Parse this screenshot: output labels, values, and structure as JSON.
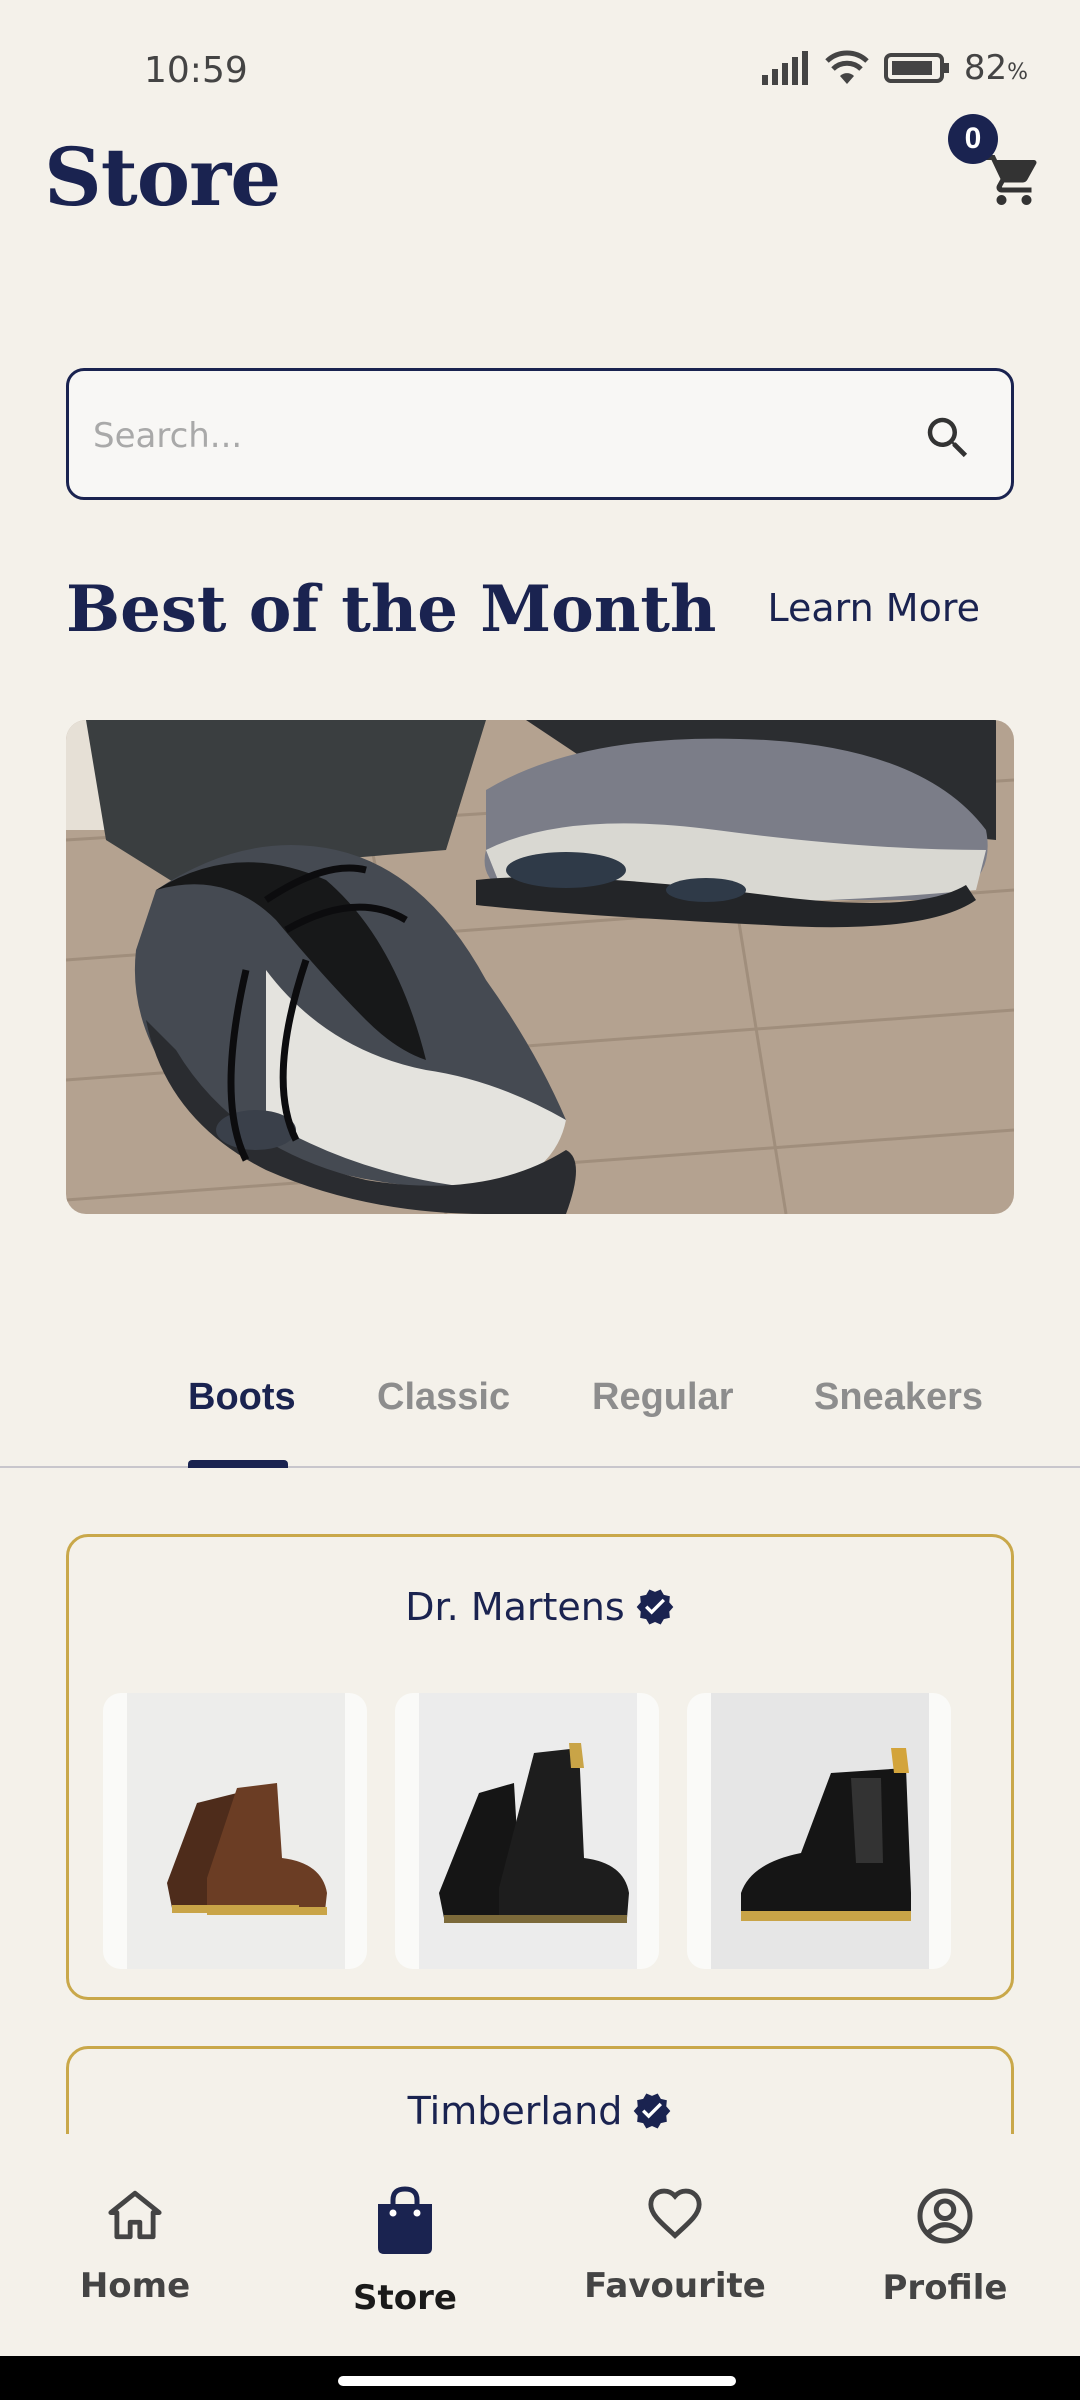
{
  "status_bar": {
    "time": "10:59",
    "battery": "82"
  },
  "header": {
    "title": "Store",
    "cart_count": "0"
  },
  "search": {
    "placeholder": "Search..."
  },
  "featured": {
    "title": "Best of the Month",
    "learn_more": "Learn More"
  },
  "tabs": [
    {
      "label": "Boots",
      "active": true
    },
    {
      "label": "Classic",
      "active": false
    },
    {
      "label": "Regular",
      "active": false
    },
    {
      "label": "Sneakers",
      "active": false
    }
  ],
  "brands": [
    {
      "name": "Dr. Martens",
      "verified": true
    },
    {
      "name": "Timberland",
      "verified": true
    }
  ],
  "bottom_nav": [
    {
      "label": "Home",
      "icon": "home-icon"
    },
    {
      "label": "Store",
      "icon": "shopping-bag-icon",
      "active": true
    },
    {
      "label": "Favourite",
      "icon": "heart-icon"
    },
    {
      "label": "Profile",
      "icon": "profile-icon"
    }
  ],
  "colors": {
    "accent": "#1a2350",
    "card_border": "#c9a84a",
    "background": "#f4f1ea"
  }
}
